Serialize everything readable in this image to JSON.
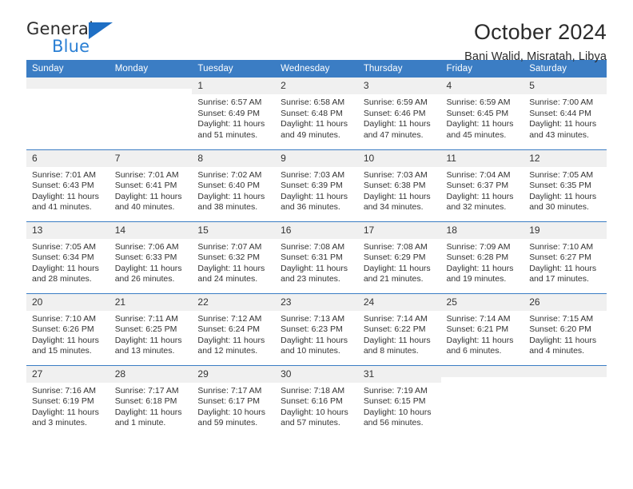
{
  "brand": {
    "name_primary": "General",
    "name_secondary": "Blue",
    "triangle_color": "#1f6fc4",
    "blue_color": "#2a7fd4"
  },
  "header": {
    "title": "October 2024",
    "subtitle": "Bani Walid, Misratah, Libya"
  },
  "theme": {
    "header_blue": "#3b7dc4",
    "daynum_bg": "#f0f0f0",
    "text": "#333333"
  },
  "weekday_headers": [
    "Sunday",
    "Monday",
    "Tuesday",
    "Wednesday",
    "Thursday",
    "Friday",
    "Saturday"
  ],
  "labels": {
    "sunrise_prefix": "Sunrise: ",
    "sunset_prefix": "Sunset: ",
    "daylight_prefix": "Daylight: "
  },
  "weeks": [
    [
      {
        "day": "",
        "blank": true
      },
      {
        "day": "",
        "blank": true
      },
      {
        "day": "1",
        "sunrise": "Sunrise: 6:57 AM",
        "sunset": "Sunset: 6:49 PM",
        "daylight1": "Daylight: 11 hours",
        "daylight2": "and 51 minutes."
      },
      {
        "day": "2",
        "sunrise": "Sunrise: 6:58 AM",
        "sunset": "Sunset: 6:48 PM",
        "daylight1": "Daylight: 11 hours",
        "daylight2": "and 49 minutes."
      },
      {
        "day": "3",
        "sunrise": "Sunrise: 6:59 AM",
        "sunset": "Sunset: 6:46 PM",
        "daylight1": "Daylight: 11 hours",
        "daylight2": "and 47 minutes."
      },
      {
        "day": "4",
        "sunrise": "Sunrise: 6:59 AM",
        "sunset": "Sunset: 6:45 PM",
        "daylight1": "Daylight: 11 hours",
        "daylight2": "and 45 minutes."
      },
      {
        "day": "5",
        "sunrise": "Sunrise: 7:00 AM",
        "sunset": "Sunset: 6:44 PM",
        "daylight1": "Daylight: 11 hours",
        "daylight2": "and 43 minutes."
      }
    ],
    [
      {
        "day": "6",
        "sunrise": "Sunrise: 7:01 AM",
        "sunset": "Sunset: 6:43 PM",
        "daylight1": "Daylight: 11 hours",
        "daylight2": "and 41 minutes."
      },
      {
        "day": "7",
        "sunrise": "Sunrise: 7:01 AM",
        "sunset": "Sunset: 6:41 PM",
        "daylight1": "Daylight: 11 hours",
        "daylight2": "and 40 minutes."
      },
      {
        "day": "8",
        "sunrise": "Sunrise: 7:02 AM",
        "sunset": "Sunset: 6:40 PM",
        "daylight1": "Daylight: 11 hours",
        "daylight2": "and 38 minutes."
      },
      {
        "day": "9",
        "sunrise": "Sunrise: 7:03 AM",
        "sunset": "Sunset: 6:39 PM",
        "daylight1": "Daylight: 11 hours",
        "daylight2": "and 36 minutes."
      },
      {
        "day": "10",
        "sunrise": "Sunrise: 7:03 AM",
        "sunset": "Sunset: 6:38 PM",
        "daylight1": "Daylight: 11 hours",
        "daylight2": "and 34 minutes."
      },
      {
        "day": "11",
        "sunrise": "Sunrise: 7:04 AM",
        "sunset": "Sunset: 6:37 PM",
        "daylight1": "Daylight: 11 hours",
        "daylight2": "and 32 minutes."
      },
      {
        "day": "12",
        "sunrise": "Sunrise: 7:05 AM",
        "sunset": "Sunset: 6:35 PM",
        "daylight1": "Daylight: 11 hours",
        "daylight2": "and 30 minutes."
      }
    ],
    [
      {
        "day": "13",
        "sunrise": "Sunrise: 7:05 AM",
        "sunset": "Sunset: 6:34 PM",
        "daylight1": "Daylight: 11 hours",
        "daylight2": "and 28 minutes."
      },
      {
        "day": "14",
        "sunrise": "Sunrise: 7:06 AM",
        "sunset": "Sunset: 6:33 PM",
        "daylight1": "Daylight: 11 hours",
        "daylight2": "and 26 minutes."
      },
      {
        "day": "15",
        "sunrise": "Sunrise: 7:07 AM",
        "sunset": "Sunset: 6:32 PM",
        "daylight1": "Daylight: 11 hours",
        "daylight2": "and 24 minutes."
      },
      {
        "day": "16",
        "sunrise": "Sunrise: 7:08 AM",
        "sunset": "Sunset: 6:31 PM",
        "daylight1": "Daylight: 11 hours",
        "daylight2": "and 23 minutes."
      },
      {
        "day": "17",
        "sunrise": "Sunrise: 7:08 AM",
        "sunset": "Sunset: 6:29 PM",
        "daylight1": "Daylight: 11 hours",
        "daylight2": "and 21 minutes."
      },
      {
        "day": "18",
        "sunrise": "Sunrise: 7:09 AM",
        "sunset": "Sunset: 6:28 PM",
        "daylight1": "Daylight: 11 hours",
        "daylight2": "and 19 minutes."
      },
      {
        "day": "19",
        "sunrise": "Sunrise: 7:10 AM",
        "sunset": "Sunset: 6:27 PM",
        "daylight1": "Daylight: 11 hours",
        "daylight2": "and 17 minutes."
      }
    ],
    [
      {
        "day": "20",
        "sunrise": "Sunrise: 7:10 AM",
        "sunset": "Sunset: 6:26 PM",
        "daylight1": "Daylight: 11 hours",
        "daylight2": "and 15 minutes."
      },
      {
        "day": "21",
        "sunrise": "Sunrise: 7:11 AM",
        "sunset": "Sunset: 6:25 PM",
        "daylight1": "Daylight: 11 hours",
        "daylight2": "and 13 minutes."
      },
      {
        "day": "22",
        "sunrise": "Sunrise: 7:12 AM",
        "sunset": "Sunset: 6:24 PM",
        "daylight1": "Daylight: 11 hours",
        "daylight2": "and 12 minutes."
      },
      {
        "day": "23",
        "sunrise": "Sunrise: 7:13 AM",
        "sunset": "Sunset: 6:23 PM",
        "daylight1": "Daylight: 11 hours",
        "daylight2": "and 10 minutes."
      },
      {
        "day": "24",
        "sunrise": "Sunrise: 7:14 AM",
        "sunset": "Sunset: 6:22 PM",
        "daylight1": "Daylight: 11 hours",
        "daylight2": "and 8 minutes."
      },
      {
        "day": "25",
        "sunrise": "Sunrise: 7:14 AM",
        "sunset": "Sunset: 6:21 PM",
        "daylight1": "Daylight: 11 hours",
        "daylight2": "and 6 minutes."
      },
      {
        "day": "26",
        "sunrise": "Sunrise: 7:15 AM",
        "sunset": "Sunset: 6:20 PM",
        "daylight1": "Daylight: 11 hours",
        "daylight2": "and 4 minutes."
      }
    ],
    [
      {
        "day": "27",
        "sunrise": "Sunrise: 7:16 AM",
        "sunset": "Sunset: 6:19 PM",
        "daylight1": "Daylight: 11 hours",
        "daylight2": "and 3 minutes."
      },
      {
        "day": "28",
        "sunrise": "Sunrise: 7:17 AM",
        "sunset": "Sunset: 6:18 PM",
        "daylight1": "Daylight: 11 hours",
        "daylight2": "and 1 minute."
      },
      {
        "day": "29",
        "sunrise": "Sunrise: 7:17 AM",
        "sunset": "Sunset: 6:17 PM",
        "daylight1": "Daylight: 10 hours",
        "daylight2": "and 59 minutes."
      },
      {
        "day": "30",
        "sunrise": "Sunrise: 7:18 AM",
        "sunset": "Sunset: 6:16 PM",
        "daylight1": "Daylight: 10 hours",
        "daylight2": "and 57 minutes."
      },
      {
        "day": "31",
        "sunrise": "Sunrise: 7:19 AM",
        "sunset": "Sunset: 6:15 PM",
        "daylight1": "Daylight: 10 hours",
        "daylight2": "and 56 minutes."
      },
      {
        "day": "",
        "blank": true
      },
      {
        "day": "",
        "blank": true
      }
    ]
  ]
}
